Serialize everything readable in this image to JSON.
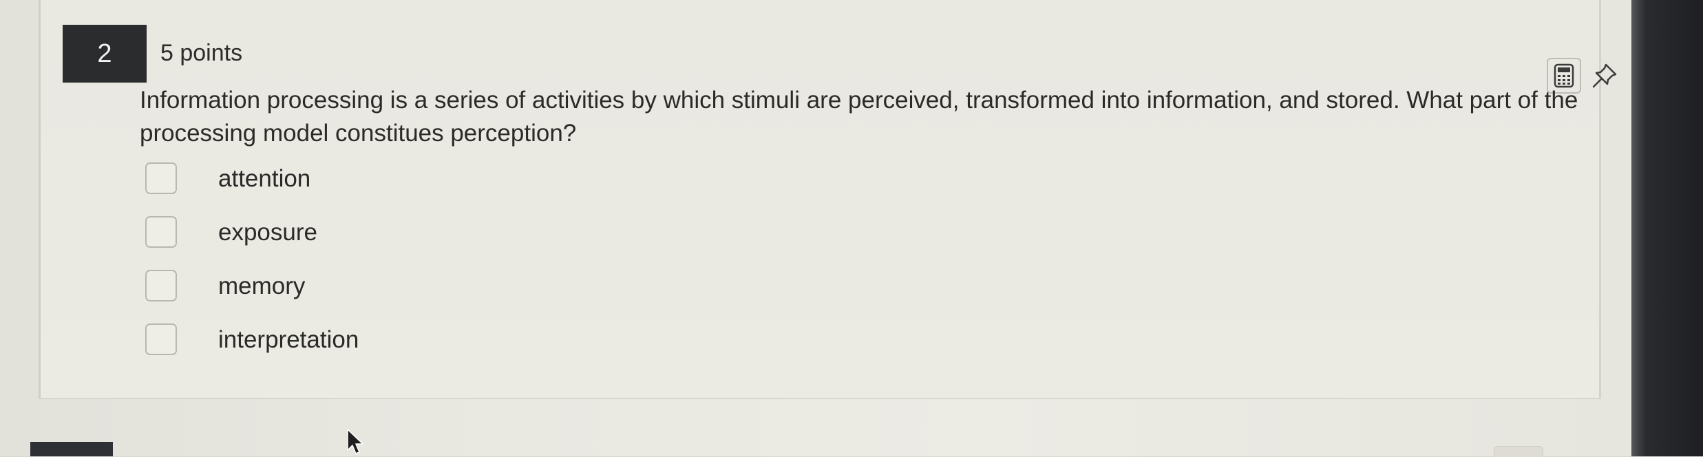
{
  "question": {
    "number": "2",
    "points": "5 points",
    "prompt": "Information processing is a series of activities by which stimuli are perceived, transformed into information, and stored.  What part of the processing model constitues perception?",
    "options": [
      {
        "label": "attention",
        "checked": false
      },
      {
        "label": "exposure",
        "checked": false
      },
      {
        "label": "memory",
        "checked": false
      },
      {
        "label": "interpretation",
        "checked": false
      }
    ]
  },
  "toolbar": {
    "calculator_icon": "calculator-icon",
    "pin_icon": "pin-icon"
  },
  "colors": {
    "number_badge": "#2b2c2e",
    "page_background": "#ebeae3",
    "checkbox_border": "#b8b7b0"
  }
}
